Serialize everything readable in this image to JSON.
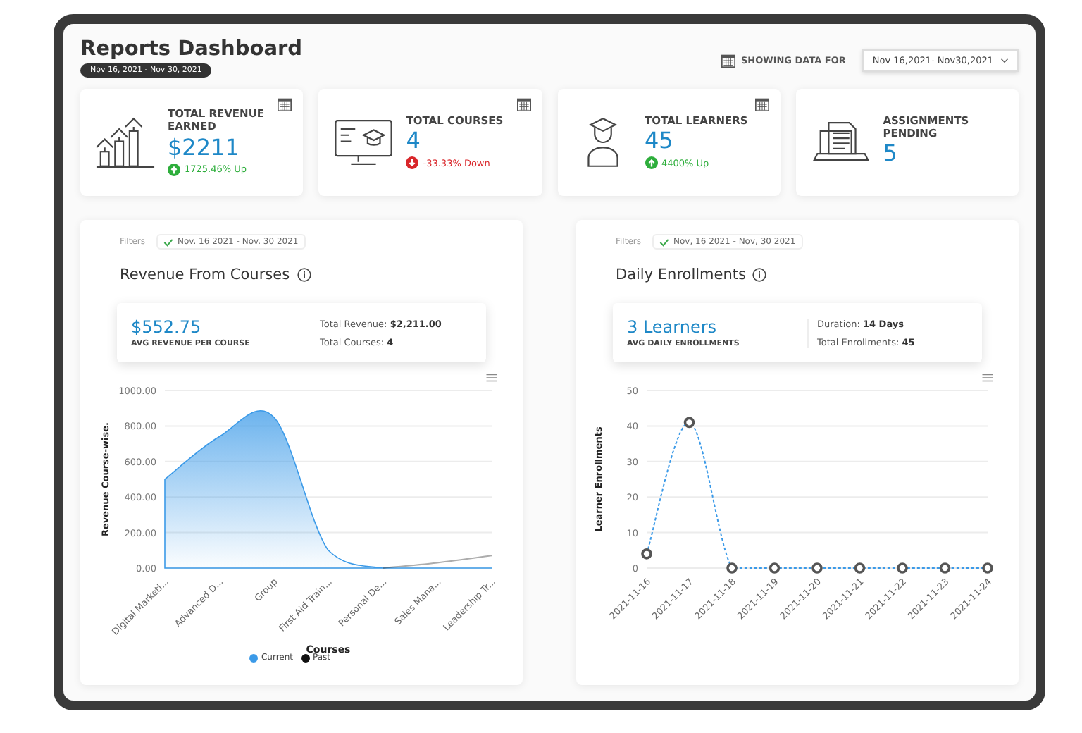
{
  "title": "Reports Dashboard",
  "date_badge": "Nov 16, 2021 - Nov 30, 2021",
  "showing_label": "SHOWING DATA FOR",
  "date_select": {
    "value": "Nov 16,2021- Nov30,2021"
  },
  "stats": [
    {
      "kind": "revenue",
      "label": "TOTAL REVENUE EARNED",
      "value": "$2211",
      "change": "1725.46% Up",
      "up": true,
      "calendar": true
    },
    {
      "kind": "courses",
      "label": "TOTAL COURSES",
      "value": "4",
      "change": "-33.33% Down",
      "up": false,
      "calendar": true
    },
    {
      "kind": "learners",
      "label": "TOTAL LEARNERS",
      "value": "45",
      "change": "4400% Up",
      "up": true,
      "calendar": true
    },
    {
      "kind": "assignments",
      "label": "ASSIGNMENTS PENDING",
      "value": "5",
      "calendar": false
    }
  ],
  "panels": [
    {
      "filters_label": "Filters",
      "filter": "Nov. 16 2021 - Nov. 30 2021",
      "title": "Revenue From Courses",
      "summary": {
        "value": "$552.75",
        "caption": "AVG REVENUE PER COURSE",
        "details": [
          {
            "label": "Total Revenue:",
            "value": "$2,211.00"
          },
          {
            "label": "Total Courses:",
            "value": "4"
          }
        ]
      },
      "chart_data": {
        "type": "area",
        "xlabel": "Courses",
        "ylabel": "Revenue Course-wise.",
        "categories": [
          "Digital Marketi...",
          "Advanced D...",
          "Group",
          "First Aid Train...",
          "Personal De...",
          "Sales Mana...",
          "Leadership Tr..."
        ],
        "ylim": [
          0,
          1000
        ],
        "grid": true,
        "yticks": [
          {
            "value": 0,
            "label": "0.00"
          },
          {
            "value": 200,
            "label": "200.00"
          },
          {
            "value": 400,
            "label": "400.00"
          },
          {
            "value": 600,
            "label": "600.00"
          },
          {
            "value": 800,
            "label": "800.00"
          },
          {
            "value": 1000,
            "label": "1000.00"
          }
        ],
        "series": [
          {
            "name": "Current",
            "color": "#3b9ae8",
            "values": [
              500,
              740,
              850,
              100,
              0,
              0,
              0
            ]
          },
          {
            "name": "Past",
            "type": "line",
            "color": "#111111",
            "values": [
              null,
              null,
              null,
              null,
              0,
              30,
              70
            ]
          }
        ]
      }
    },
    {
      "filters_label": "Filters",
      "filter": "Nov, 16 2021 - Nov, 30 2021",
      "title": "Daily Enrollments",
      "summary": {
        "value": "3 Learners",
        "caption": "AVG DAILY ENROLLMENTS",
        "details": [
          {
            "label": "Duration:",
            "value": "14 Days"
          },
          {
            "label": "Total Enrollments:",
            "value": "45"
          }
        ]
      },
      "chart_data": {
        "type": "line",
        "ylabel": "Learner Enrollments",
        "categories": [
          "2021-11-16",
          "2021-11-17",
          "2021-11-18",
          "2021-11-19",
          "2021-11-20",
          "2021-11-21",
          "2021-11-22",
          "2021-11-23",
          "2021-11-24"
        ],
        "ylim": [
          0,
          50
        ],
        "grid": true,
        "yticks": [
          0,
          10,
          20,
          30,
          40,
          50
        ],
        "series": [
          {
            "color": "#3b9ae8",
            "line_style": "dashed",
            "marker": "circle",
            "values": [
              4,
              41,
              0,
              0,
              0,
              0,
              0,
              0,
              0
            ]
          }
        ]
      }
    }
  ]
}
